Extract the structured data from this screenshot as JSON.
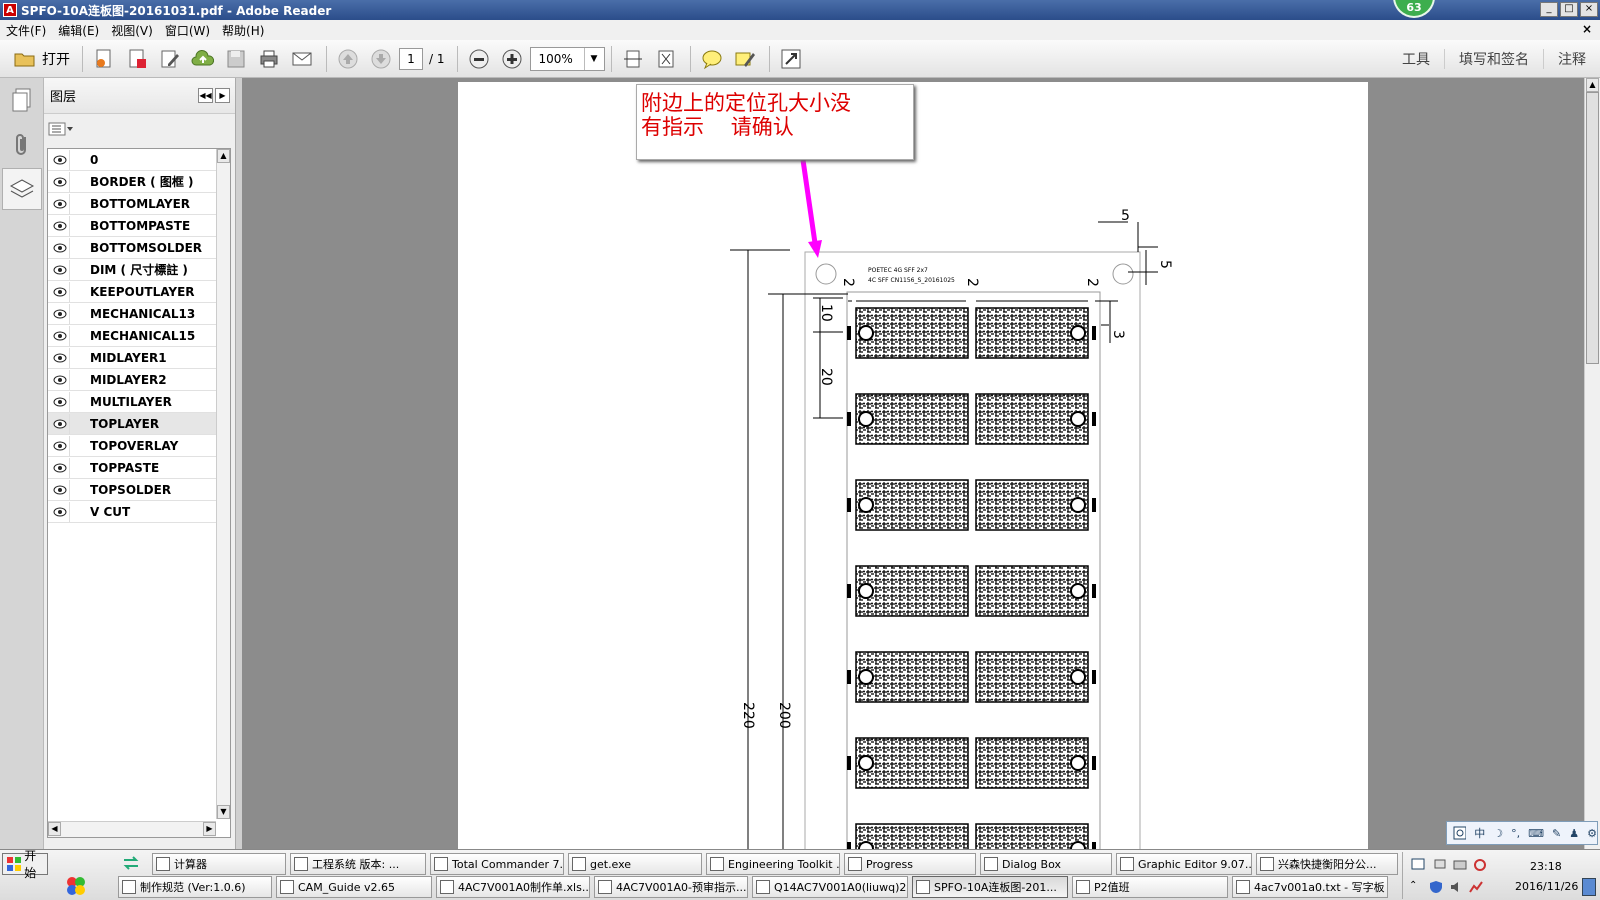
{
  "window": {
    "title": "SPFO-10A连板图-20161031.pdf - Adobe Reader",
    "app_icon": "pdf-icon",
    "notification_count": "63",
    "minimize": "_",
    "maximize": "□",
    "close": "×"
  },
  "menu": {
    "items": [
      "文件(F)",
      "编辑(E)",
      "视图(V)",
      "窗口(W)",
      "帮助(H)"
    ],
    "close_glyph": "×"
  },
  "toolbar": {
    "open_label": "打开",
    "page_current": "1",
    "page_total": "/ 1",
    "zoom": "100%",
    "right": [
      "工具",
      "填写和签名",
      "注释"
    ]
  },
  "layers_panel": {
    "title": "图层",
    "layers": [
      {
        "name": "0",
        "highlighted": false
      },
      {
        "name": "BORDER ( 图框 )",
        "highlighted": false
      },
      {
        "name": "BOTTOMLAYER",
        "highlighted": false
      },
      {
        "name": "BOTTOMPASTE",
        "highlighted": false
      },
      {
        "name": "BOTTOMSOLDER",
        "highlighted": false
      },
      {
        "name": "DIM ( 尺寸標註 )",
        "highlighted": false
      },
      {
        "name": "KEEPOUTLAYER",
        "highlighted": false
      },
      {
        "name": "MECHANICAL13",
        "highlighted": false
      },
      {
        "name": "MECHANICAL15",
        "highlighted": false
      },
      {
        "name": "MIDLAYER1",
        "highlighted": false
      },
      {
        "name": "MIDLAYER2",
        "highlighted": false
      },
      {
        "name": "MULTILAYER",
        "highlighted": false
      },
      {
        "name": "TOPLAYER",
        "highlighted": true
      },
      {
        "name": "TOPOVERLAY",
        "highlighted": false
      },
      {
        "name": "TOPPASTE",
        "highlighted": false
      },
      {
        "name": "TOPSOLDER",
        "highlighted": false
      },
      {
        "name": "V CUT",
        "highlighted": false
      }
    ]
  },
  "document": {
    "comment": "附边上的定位孔大小没\n有指示    请确认",
    "pcb_label_1": "POETEC 4G SFF 2x7",
    "pcb_label_2": "4C SFF CN1156_S_20161025",
    "dims": {
      "d5a": "5",
      "d5b": "5",
      "d2a": "2",
      "d2b": "2",
      "d2c": "2",
      "d10": "10",
      "d20": "20",
      "d3": "3",
      "d220": "220",
      "d200": "200"
    },
    "arrow_color": "#ff00ff",
    "comment_color": "#dd0000"
  },
  "ime": {
    "items": [
      "中",
      "☽",
      "°,",
      "⌨",
      "✎",
      "♟",
      "⚙"
    ]
  },
  "taskbar": {
    "start": "开始",
    "row1": [
      {
        "label": "计算器",
        "icon": "calculator-icon"
      },
      {
        "label": "工程系统  版本: ...",
        "icon": "engineering-icon"
      },
      {
        "label": "Total Commander 7....",
        "icon": "disk-icon"
      },
      {
        "label": "get.exe",
        "icon": "globe-icon"
      },
      {
        "label": "Engineering Toolkit ...",
        "icon": "toolkit-icon"
      },
      {
        "label": "Progress",
        "icon": "progress-icon"
      },
      {
        "label": "Dialog Box",
        "icon": "dialog-icon"
      },
      {
        "label": "Graphic Editor 9.07...",
        "icon": "editor-icon"
      },
      {
        "label": "兴森快捷衡阳分公...",
        "icon": "star-icon"
      }
    ],
    "row2": [
      {
        "label": "制作规范 (Ver:1.0.6)",
        "icon": "doc-icon"
      },
      {
        "label": "CAM_Guide v2.65",
        "icon": "guide-icon"
      },
      {
        "label": "4AC7V001A0制作单.xls...",
        "icon": "excel-icon"
      },
      {
        "label": "4AC7V001A0-预审指示...",
        "icon": "excel-icon"
      },
      {
        "label": "Q14AC7V001A0(liuwq)2...",
        "icon": "excel-icon"
      },
      {
        "label": "SPFO-10A连板图-201...",
        "icon": "pdf-icon"
      },
      {
        "label": "P2值班",
        "icon": "p2-icon"
      },
      {
        "label": "4ac7v001a0.txt - 写字板",
        "icon": "wordpad-icon"
      }
    ],
    "time": "23:18",
    "date": "2016/11/26"
  }
}
